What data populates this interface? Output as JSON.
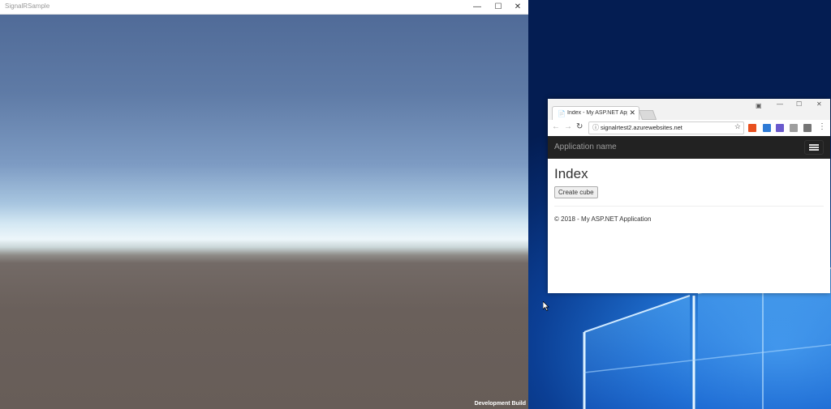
{
  "unity": {
    "title": "SignalRSample",
    "minimize": "—",
    "maximize": "☐",
    "close": "✕",
    "watermark": "Development Build"
  },
  "chrome": {
    "tab_title": "Index - My ASP.NET App",
    "tab_close": "✕",
    "window_minimize": "—",
    "window_maximize": "☐",
    "window_close": "✕",
    "url": "signalrtest2.azurewebsites.net",
    "extension_colors": [
      "#e8501f",
      "#2e7bd6",
      "#6a5acd",
      "#9e9e9e",
      "#757575"
    ]
  },
  "site": {
    "brand": "Application name",
    "heading": "Index",
    "create_button": "Create cube",
    "footer": "© 2018 - My ASP.NET Application"
  },
  "icons": [
    "windows-logo",
    "tab-page-icon",
    "back-arrow-icon",
    "forward-arrow-icon",
    "reload-icon",
    "info-icon",
    "star-icon",
    "hamburger-menu-icon",
    "mouse-cursor-icon"
  ]
}
